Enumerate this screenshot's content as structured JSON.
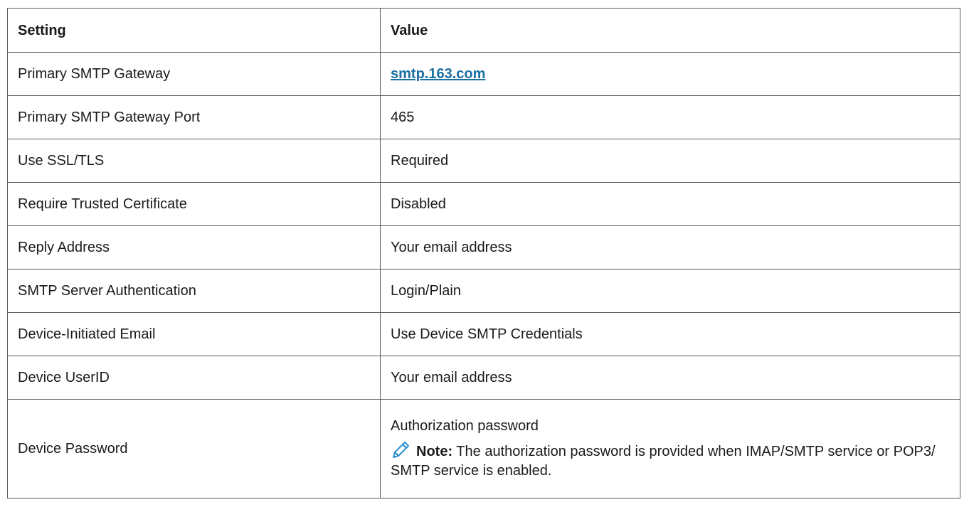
{
  "table": {
    "headers": [
      "Setting",
      "Value"
    ],
    "rows": [
      {
        "setting": "Primary SMTP Gateway",
        "value": "smtp.163.com"
      },
      {
        "setting": "Primary SMTP Gateway Port",
        "value": "465"
      },
      {
        "setting": "Use SSL/TLS",
        "value": "Required"
      },
      {
        "setting": "Require Trusted Certificate",
        "value": "Disabled"
      },
      {
        "setting": "Reply Address",
        "value": "Your email address"
      },
      {
        "setting": "SMTP Server Authentication",
        "value": "Login/Plain"
      },
      {
        "setting": "Device-Initiated Email",
        "value": "Use Device SMTP Credentials"
      },
      {
        "setting": "Device UserID",
        "value": "Your email address"
      },
      {
        "setting": "Device Password",
        "value": "Authorization password"
      }
    ],
    "note": {
      "icon": "pencil-icon",
      "label": "Note:",
      "text": " The authorization password is provided when IMAP/SMTP service or POP3/ SMTP service is enabled."
    }
  },
  "colors": {
    "link": "#1a6fa3",
    "border": "#5a5a5a",
    "note_icon": "#2a8fd0"
  }
}
